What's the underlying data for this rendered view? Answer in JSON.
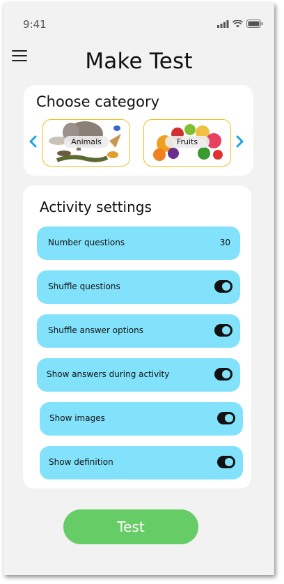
{
  "status_bar": {
    "time": "9:41"
  },
  "header": {
    "title": "Make Test"
  },
  "category": {
    "title": "Choose category",
    "items": [
      {
        "label": "Animals"
      },
      {
        "label": "Fruits"
      }
    ]
  },
  "settings": {
    "title": "Activity settings",
    "rows": [
      {
        "label": "Number questions",
        "value": "30"
      },
      {
        "label": "Shuffle questions",
        "enabled": true
      },
      {
        "label": "Shuffle answer options",
        "enabled": true
      },
      {
        "label": "Show answers during activity",
        "enabled": true
      },
      {
        "label": "Show images",
        "enabled": true
      },
      {
        "label": "Show definition",
        "enabled": true
      }
    ]
  },
  "action": {
    "test_label": "Test"
  },
  "colors": {
    "accent_cyan": "#82e2fb",
    "button_green": "#66cc66",
    "tile_border": "#f0c020",
    "arrow_blue": "#1aa3e8"
  }
}
